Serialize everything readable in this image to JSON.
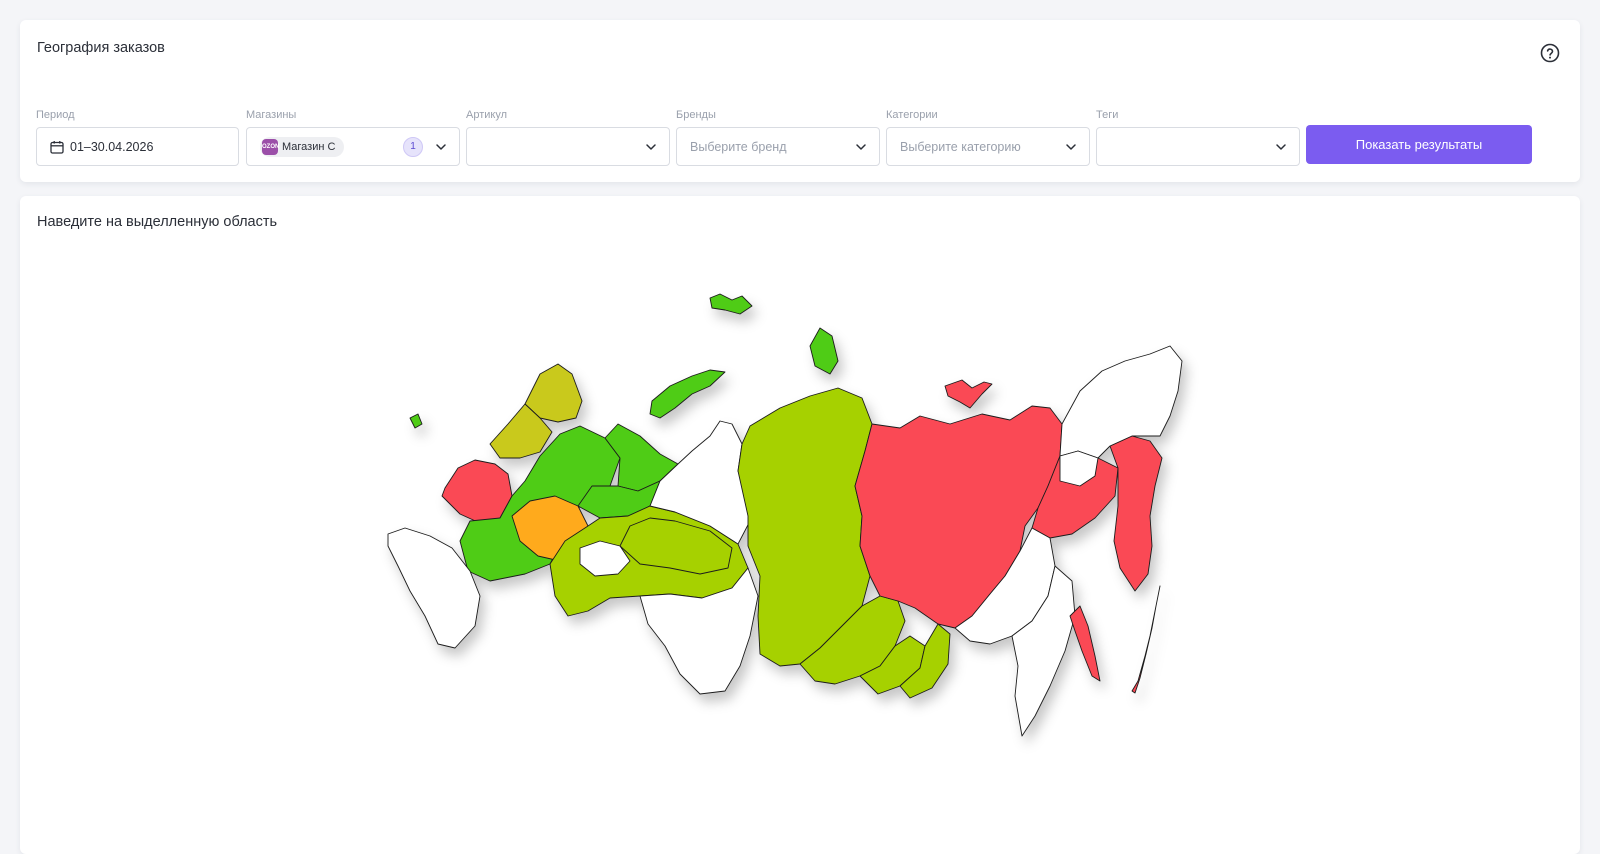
{
  "header": {
    "title": "География заказов"
  },
  "filters": {
    "period": {
      "label": "Период",
      "value": "01–30.04.2026"
    },
    "shops": {
      "label": "Магазины",
      "chip_label": "Магазин С",
      "chip_logo": "OZON",
      "count": "1"
    },
    "article": {
      "label": "Артикул",
      "value": ""
    },
    "brands": {
      "label": "Бренды",
      "placeholder": "Выберите бренд"
    },
    "categories": {
      "label": "Категории",
      "placeholder": "Выберите категорию"
    },
    "tags": {
      "label": "Теги",
      "value": ""
    },
    "submit_label": "Показать результаты"
  },
  "map": {
    "hint": "Наведите на выделленную область",
    "colors": {
      "red": "#fa4a55",
      "orange": "#ffaa1f",
      "green": "#4fcc14",
      "yellow_green": "#a6d100",
      "olive": "#c9c91a",
      "white": "#ffffff",
      "background": "#ffffff"
    },
    "regions": [
      {
        "name": "sakha-yakutia",
        "color": "red"
      },
      {
        "name": "khabarovsk",
        "color": "red"
      },
      {
        "name": "kamchatka",
        "color": "red"
      },
      {
        "name": "sakhalin",
        "color": "red"
      },
      {
        "name": "kuril-islands",
        "color": "red"
      },
      {
        "name": "new-siberian-islands",
        "color": "red"
      },
      {
        "name": "krasnoyarsk",
        "color": "yellow_green"
      },
      {
        "name": "irkutsk",
        "color": "yellow_green"
      },
      {
        "name": "buryatia",
        "color": "yellow_green"
      },
      {
        "name": "zabaykalsky",
        "color": "yellow_green"
      },
      {
        "name": "khanty-mansi",
        "color": "yellow_green"
      },
      {
        "name": "komi",
        "color": "green"
      },
      {
        "name": "novaya-zemlya",
        "color": "green"
      },
      {
        "name": "franz-josef-land",
        "color": "green"
      },
      {
        "name": "severnaya-zemlya",
        "color": "green"
      },
      {
        "name": "arkhangelsk",
        "color": "green"
      },
      {
        "name": "karelia",
        "color": "olive"
      },
      {
        "name": "murmansk",
        "color": "olive"
      },
      {
        "name": "central-russia",
        "color": "green"
      },
      {
        "name": "volga-center",
        "color": "orange"
      },
      {
        "name": "northwest-red",
        "color": "red"
      },
      {
        "name": "urals",
        "color": "yellow_green"
      },
      {
        "name": "yamal",
        "color": "white"
      },
      {
        "name": "chukotka",
        "color": "white"
      },
      {
        "name": "magadan",
        "color": "white"
      },
      {
        "name": "amur",
        "color": "white"
      },
      {
        "name": "primorsky",
        "color": "white"
      },
      {
        "name": "south-siberia",
        "color": "white"
      },
      {
        "name": "north-caucasus",
        "color": "white"
      },
      {
        "name": "orenburg",
        "color": "white"
      },
      {
        "name": "kaliningrad",
        "color": "green"
      }
    ]
  }
}
